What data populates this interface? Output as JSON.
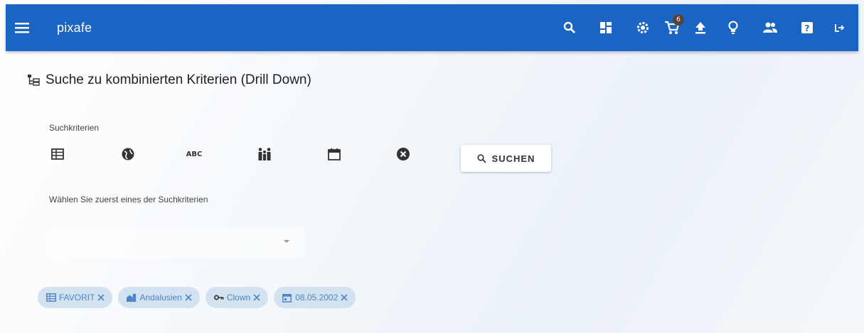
{
  "appbar": {
    "brand": "pixafe",
    "bg_color": "#1a64c4",
    "icons": [
      "menu-icon",
      "search-icon",
      "dashboard-icon",
      "settings-icon",
      "cart-icon",
      "upload-icon",
      "lightbulb-icon",
      "group-icon",
      "help-icon",
      "logout-icon"
    ],
    "cart_count": "6"
  },
  "page": {
    "title": "Suche zu kombinierten Kriterien (Drill Down)",
    "title_icon": "tree-icon"
  },
  "criteria": {
    "label": "Suchkriterien",
    "icons": [
      "table-icon",
      "globe-icon",
      "abc-icon",
      "people-icon",
      "calendar-icon",
      "clear-icon"
    ],
    "abc_text": "ABC",
    "search_button": "SUCHEN"
  },
  "hint": "Wählen Sie zuerst eines der Suchkriterien",
  "select": {
    "value": ""
  },
  "chips": [
    {
      "label": "FAVORIT",
      "icon": "table-icon"
    },
    {
      "label": "Andalusien",
      "icon": "city-icon"
    },
    {
      "label": "Clown",
      "icon": "key-icon"
    },
    {
      "label": "08.05.2002",
      "icon": "calendar-icon"
    }
  ],
  "colors": {
    "chip_bg": "#d3e2f1",
    "chip_text": "#4d86c6",
    "badge": "#5d4037"
  }
}
